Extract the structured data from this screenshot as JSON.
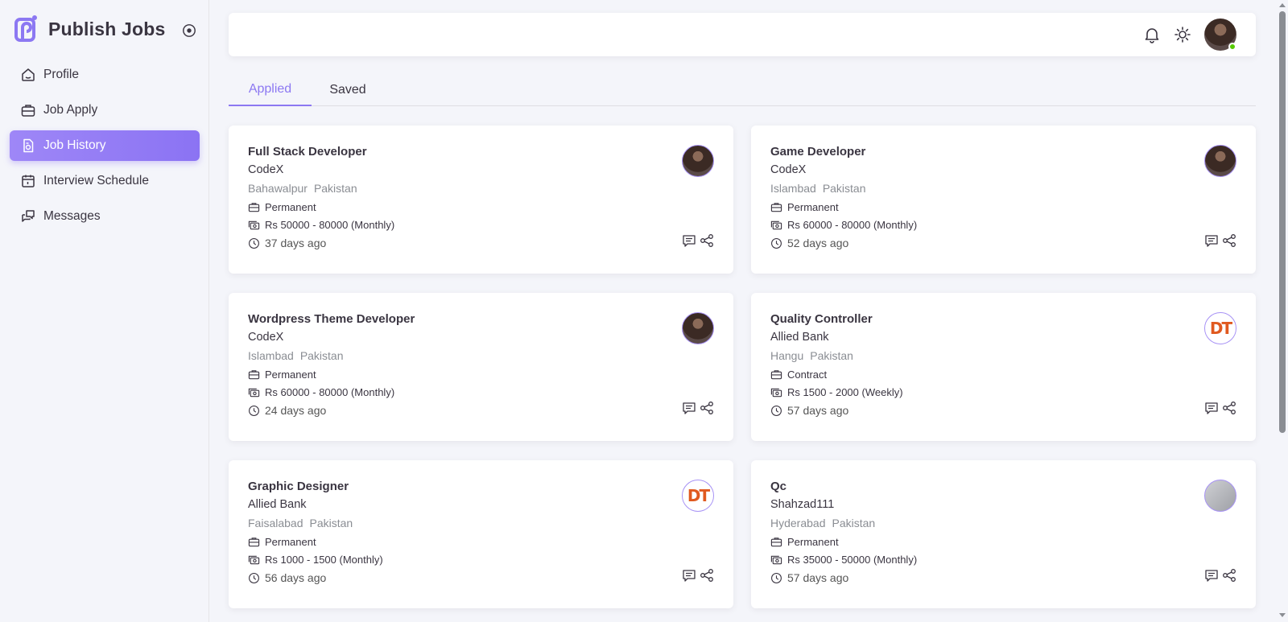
{
  "brand": {
    "title": "Publish Jobs"
  },
  "nav": [
    {
      "label": "Profile",
      "icon": "home-icon",
      "active": false
    },
    {
      "label": "Job Apply",
      "icon": "briefcase-icon",
      "active": false
    },
    {
      "label": "Job History",
      "icon": "document-icon",
      "active": true
    },
    {
      "label": "Interview Schedule",
      "icon": "calendar-icon",
      "active": false
    },
    {
      "label": "Messages",
      "icon": "chat-icon",
      "active": false
    }
  ],
  "tabs": [
    {
      "label": "Applied",
      "active": true
    },
    {
      "label": "Saved",
      "active": false
    }
  ],
  "colors": {
    "accent": "#8c78f2",
    "online": "#56ca00"
  },
  "jobs": [
    {
      "title": "Full Stack Developer",
      "company": "CodeX",
      "city": "Bahawalpur",
      "country": "Pakistan",
      "type": "Permanent",
      "salary": "Rs 50000 - 80000 (Monthly)",
      "posted": "37 days ago",
      "logo": "person"
    },
    {
      "title": "Game Developer",
      "company": "CodeX",
      "city": "Islambad",
      "country": "Pakistan",
      "type": "Permanent",
      "salary": "Rs 60000 - 80000 (Monthly)",
      "posted": "52 days ago",
      "logo": "person"
    },
    {
      "title": "Wordpress Theme Developer",
      "company": "CodeX",
      "city": "Islambad",
      "country": "Pakistan",
      "type": "Permanent",
      "salary": "Rs 60000 - 80000 (Monthly)",
      "posted": "24 days ago",
      "logo": "person"
    },
    {
      "title": "Quality Controller",
      "company": "Allied Bank",
      "city": "Hangu",
      "country": "Pakistan",
      "type": "Contract",
      "salary": "Rs 1500 - 2000 (Weekly)",
      "posted": "57 days ago",
      "logo": "dt"
    },
    {
      "title": "Graphic Designer",
      "company": "Allied Bank",
      "city": "Faisalabad",
      "country": "Pakistan",
      "type": "Permanent",
      "salary": "Rs 1000 - 1500 (Monthly)",
      "posted": "56 days ago",
      "logo": "dt"
    },
    {
      "title": "Qc",
      "company": "Shahzad111",
      "city": "Hyderabad",
      "country": "Pakistan",
      "type": "Permanent",
      "salary": "Rs 35000 - 50000 (Monthly)",
      "posted": "57 days ago",
      "logo": "grey"
    }
  ],
  "logo_text": {
    "dt": "DT"
  }
}
